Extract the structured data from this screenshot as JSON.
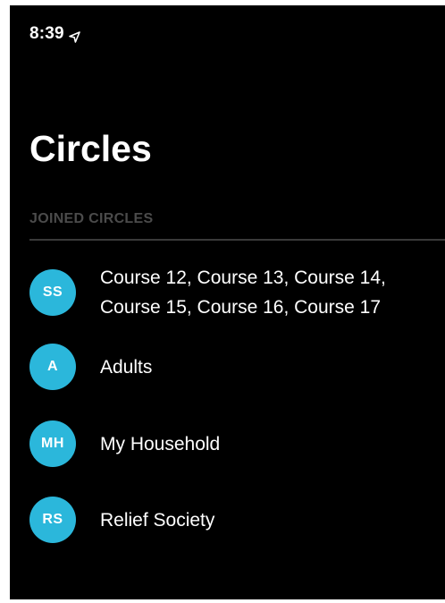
{
  "status_bar": {
    "time": "8:39",
    "location_icon": "location-arrow-icon"
  },
  "page": {
    "title": "Circles"
  },
  "section": {
    "header": "JOINED CIRCLES"
  },
  "circles": [
    {
      "initials": "SS",
      "name_lines": [
        "Course 12, Course 13, Course 14,",
        "Course 15, Course 16, Course 17"
      ]
    },
    {
      "initials": "A",
      "name_lines": [
        "Adults"
      ]
    },
    {
      "initials": "MH",
      "name_lines": [
        "My Household"
      ]
    },
    {
      "initials": "RS",
      "name_lines": [
        "Relief Society"
      ]
    }
  ],
  "colors": {
    "background": "#000000",
    "avatar": "#2bb7db",
    "text": "#ffffff",
    "section_header": "#4b4b4b"
  }
}
